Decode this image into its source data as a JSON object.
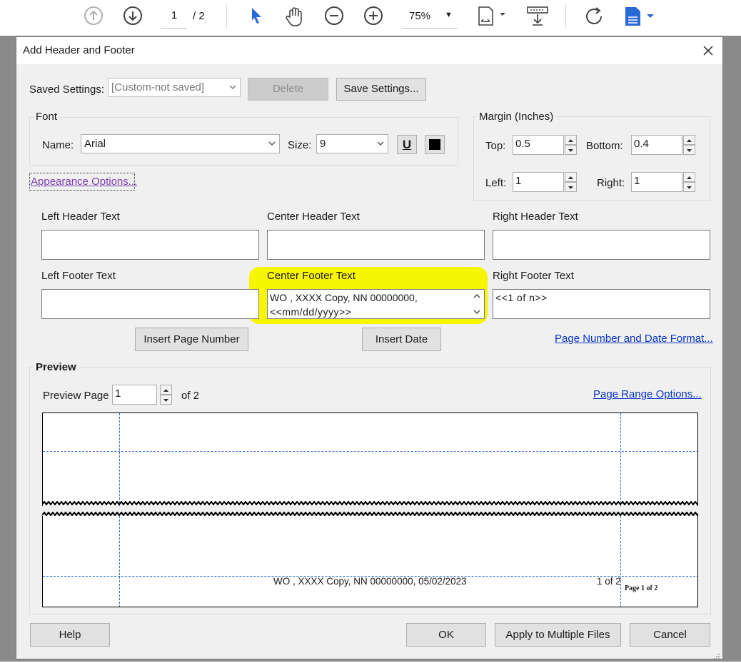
{
  "toolbar": {
    "page_current": "1",
    "page_total": "/ 2",
    "zoom": "75%",
    "icons": [
      "prev-page-icon",
      "next-page-icon",
      "select-arrow-icon",
      "hand-icon",
      "zoom-out-icon",
      "zoom-in-icon",
      "fit-page-icon",
      "scroll-mode-icon",
      "rotate-icon",
      "save-file-icon"
    ]
  },
  "dialog": {
    "title": "Add Header and Footer",
    "saved_settings_label": "Saved Settings:",
    "saved_settings_value": "[Custom-not saved]",
    "delete_label": "Delete",
    "save_settings_label": "Save Settings...",
    "font": {
      "group_title": "Font",
      "name_label": "Name:",
      "name_value": "Arial",
      "size_label": "Size:",
      "size_value": "9",
      "underline_glyph": "U",
      "color_hex": "#000000"
    },
    "margin": {
      "group_title": "Margin (Inches)",
      "top_label": "Top:",
      "top_value": "0.5",
      "bottom_label": "Bottom:",
      "bottom_value": "0.4",
      "left_label": "Left:",
      "left_value": "1",
      "right_label": "Right:",
      "right_value": "1"
    },
    "appearance_options": "Appearance Options...",
    "left_header_label": "Left Header Text",
    "center_header_label": "Center Header Text",
    "right_header_label": "Right Header Text",
    "left_footer_label": "Left Footer Text",
    "center_footer_label": "Center Footer Text",
    "right_footer_label": "Right Footer Text",
    "center_footer_line1": "WO , XXXX Copy, NN 00000000,",
    "center_footer_line2": "<<mm/dd/yyyy>>",
    "right_footer_value": "<<1 of n>>",
    "insert_page_number": "Insert Page Number",
    "insert_date": "Insert Date",
    "page_number_date_format": "Page Number and Date Format...",
    "preview": {
      "group_title": "Preview",
      "preview_page_label": "Preview Page",
      "preview_page_value": "1",
      "of_label": "of 2",
      "page_range_options": "Page Range Options...",
      "footer_center_text": "WO , XXXX Copy, NN 00000000, 05/02/2023",
      "footer_right_text": "1 of 2",
      "page_stamp": "Page 1 of 2"
    },
    "buttons": {
      "help": "Help",
      "ok": "OK",
      "apply_multiple": "Apply to Multiple Files",
      "cancel": "Cancel"
    }
  },
  "colors": {
    "highlight": "#f6f600",
    "link": "#0b35c6",
    "guide_lines": "#2f6fd1",
    "accent_icon": "#2a6ad4"
  }
}
